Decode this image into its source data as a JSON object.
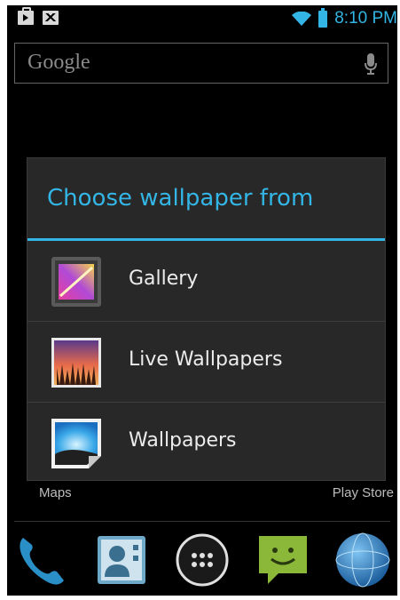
{
  "status_bar": {
    "time": "8:10 PM",
    "left_icons": [
      "shopping-bag-icon",
      "gmail-icon"
    ],
    "right_icons": [
      "wifi-icon",
      "battery-icon"
    ],
    "accent_color": "#33b5e5"
  },
  "search_bar": {
    "logo_text": "Google",
    "icon": "microphone-icon"
  },
  "dialog": {
    "title": "Choose wallpaper from",
    "options": [
      {
        "label": "Gallery",
        "icon": "gallery-icon"
      },
      {
        "label": "Live Wallpapers",
        "icon": "live-wallpapers-icon"
      },
      {
        "label": "Wallpapers",
        "icon": "wallpapers-icon"
      }
    ]
  },
  "home": {
    "labels": {
      "maps": "Maps",
      "play_store": "Play Store"
    },
    "dock": [
      {
        "name": "phone-icon"
      },
      {
        "name": "contacts-icon"
      },
      {
        "name": "all-apps-icon"
      },
      {
        "name": "messaging-icon"
      },
      {
        "name": "browser-icon"
      }
    ]
  }
}
